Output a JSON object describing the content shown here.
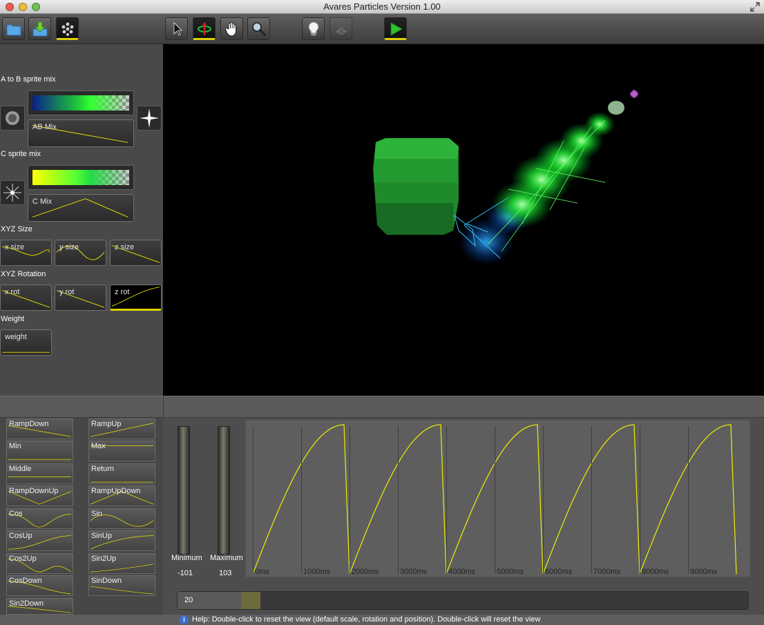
{
  "window": {
    "title": "Avares Particles Version 1.00"
  },
  "toolbar": {
    "buttons": [
      "open-folder",
      "download",
      "particles",
      "select-arrow",
      "rotate",
      "hand-pan",
      "zoom",
      "light-bulb",
      "grid-view",
      "play"
    ]
  },
  "left_panel": {
    "ab_section": {
      "label": "A to B sprite mix",
      "mix_label": "AB Mix",
      "gradient_colors": [
        "#0a1f8a",
        "#1cc23a",
        "#33ff33"
      ]
    },
    "c_section": {
      "label": "C sprite mix",
      "mix_label": "C Mix",
      "gradient_colors": [
        "#ffff00",
        "#55ff33",
        "#22dd44"
      ]
    },
    "xyz_size": {
      "label": "XYZ Size",
      "x": "x size",
      "y": "y size",
      "z": "z size"
    },
    "xyz_rotation": {
      "label": "XYZ Rotation",
      "x": "x rot",
      "y": "y rot",
      "z": "z rot"
    },
    "weight": {
      "label": "Weight",
      "weight": "weight"
    }
  },
  "presets": [
    {
      "label": "RampDown"
    },
    {
      "label": "RampUp"
    },
    {
      "label": "Min"
    },
    {
      "label": "Max"
    },
    {
      "label": "Middle"
    },
    {
      "label": "Return"
    },
    {
      "label": "RampDownUp"
    },
    {
      "label": "RampUpDown"
    },
    {
      "label": "Cos"
    },
    {
      "label": "Sin"
    },
    {
      "label": "CosUp"
    },
    {
      "label": "SinUp"
    },
    {
      "label": "Cos2Up"
    },
    {
      "label": "Sin2Up"
    },
    {
      "label": "CosDown"
    },
    {
      "label": "SinDown"
    },
    {
      "label": "Sin2Down"
    }
  ],
  "editor": {
    "min_label": "Minimum",
    "max_label": "Maximum",
    "min_value": "-101",
    "max_value": "103",
    "time_ticks": [
      "0ms",
      "1000ms",
      "2000ms",
      "3000ms",
      "4000ms",
      "5000ms",
      "6000ms",
      "7000ms",
      "8000ms",
      "9000ms"
    ],
    "track_value": "20",
    "curve_color": "#f0f000"
  },
  "status": {
    "help": "Help: Double-click to reset the view (default scale, rotation and position). Double-click will reset the view",
    "info_icon": "i"
  },
  "colors": {
    "accent": "#e0d000"
  }
}
